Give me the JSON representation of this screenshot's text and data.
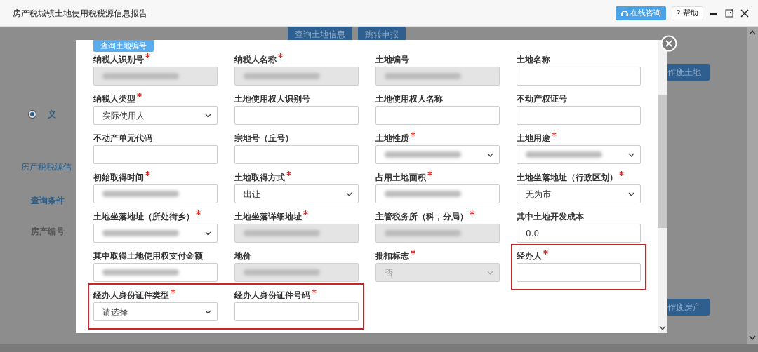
{
  "window": {
    "title": "房产税城镇土地使用税税源信息报告",
    "buttons": [
      {
        "label": "在线咨询",
        "kind": "consult"
      },
      {
        "label": "? 帮助",
        "kind": "help"
      }
    ]
  },
  "background": {
    "top_buttons": [
      "查询土地信息",
      "跳转申报"
    ],
    "side_buttons": [
      "作废土地",
      "作废房产"
    ],
    "section_title": "房产税税源信",
    "tab": "查询条件",
    "filter_label": "房产编号",
    "radio": {
      "selected": true,
      "label": "义"
    }
  },
  "dialog": {
    "top_button": "查询土地编号",
    "rows": [
      [
        {
          "label": "纳税人识别号",
          "kind": "text",
          "required": true,
          "disabled": true,
          "redacted": true,
          "highlighted": false
        },
        {
          "label": "纳税人名称",
          "kind": "text",
          "required": true,
          "disabled": true,
          "redacted": true,
          "highlighted": false
        },
        {
          "label": "土地编号",
          "kind": "text",
          "required": false,
          "disabled": true,
          "redacted": true,
          "highlighted": false
        },
        {
          "label": "土地名称",
          "kind": "text",
          "required": false,
          "disabled": false,
          "redacted": false,
          "highlighted": false
        }
      ],
      [
        {
          "label": "纳税人类型",
          "kind": "select",
          "required": true,
          "disabled": false,
          "redacted": false,
          "value": "实际使用人",
          "highlighted": false
        },
        {
          "label": "土地使用权人识别号",
          "kind": "text",
          "required": false,
          "disabled": false,
          "redacted": false,
          "highlighted": false
        },
        {
          "label": "土地使用权人名称",
          "kind": "text",
          "required": false,
          "disabled": false,
          "redacted": false,
          "highlighted": false
        },
        {
          "label": "不动产权证号",
          "kind": "text",
          "required": false,
          "disabled": false,
          "redacted": false,
          "highlighted": false
        }
      ],
      [
        {
          "label": "不动产单元代码",
          "kind": "text",
          "required": false,
          "disabled": false,
          "redacted": false,
          "highlighted": false
        },
        {
          "label": "宗地号（丘号）",
          "kind": "text",
          "required": false,
          "disabled": false,
          "redacted": false,
          "highlighted": false
        },
        {
          "label": "土地性质",
          "kind": "select",
          "required": true,
          "disabled": false,
          "redacted": true,
          "highlighted": false
        },
        {
          "label": "土地用途",
          "kind": "select",
          "required": true,
          "disabled": false,
          "redacted": true,
          "highlighted": false
        }
      ],
      [
        {
          "label": "初始取得时间",
          "kind": "text",
          "required": true,
          "disabled": false,
          "redacted": true,
          "highlighted": false
        },
        {
          "label": "土地取得方式",
          "kind": "select",
          "required": true,
          "disabled": false,
          "redacted": false,
          "value": "出让",
          "highlighted": false
        },
        {
          "label": "占用土地面积",
          "kind": "text",
          "required": true,
          "disabled": false,
          "redacted": true,
          "highlighted": false
        },
        {
          "label": "土地坐落地址（行政区划）",
          "kind": "select",
          "required": true,
          "disabled": false,
          "redacted": false,
          "value": "无为市",
          "highlighted": false
        }
      ],
      [
        {
          "label": "土地坐落地址（所处街乡）",
          "kind": "select",
          "required": true,
          "disabled": false,
          "redacted": true,
          "highlighted": false
        },
        {
          "label": "土地坐落详细地址",
          "kind": "text",
          "required": true,
          "disabled": true,
          "redacted": true,
          "highlighted": false
        },
        {
          "label": "主管税务所（科，分局）",
          "kind": "text",
          "required": true,
          "disabled": true,
          "redacted": true,
          "highlighted": false
        },
        {
          "label": "其中土地开发成本",
          "kind": "text",
          "required": false,
          "disabled": false,
          "redacted": false,
          "value": "0.0",
          "highlighted": false
        }
      ],
      [
        {
          "label": "其中取得土地使用权支付金额",
          "kind": "text",
          "required": false,
          "disabled": false,
          "redacted": true,
          "highlighted": false
        },
        {
          "label": "地价",
          "kind": "text",
          "required": false,
          "disabled": true,
          "redacted": true,
          "highlighted": false
        },
        {
          "label": "批扣标志",
          "kind": "select",
          "required": true,
          "disabled": true,
          "redacted": false,
          "value": "否",
          "highlighted": false
        },
        {
          "label": "经办人",
          "kind": "text",
          "required": true,
          "disabled": false,
          "redacted": false,
          "highlighted": true
        }
      ],
      [
        {
          "label": "经办人身份证件类型",
          "kind": "select",
          "required": true,
          "disabled": false,
          "redacted": false,
          "value": "请选择",
          "highlighted": true
        },
        {
          "label": "经办人身份证件号码",
          "kind": "text",
          "required": true,
          "disabled": false,
          "redacted": false,
          "highlighted": true
        }
      ]
    ]
  }
}
